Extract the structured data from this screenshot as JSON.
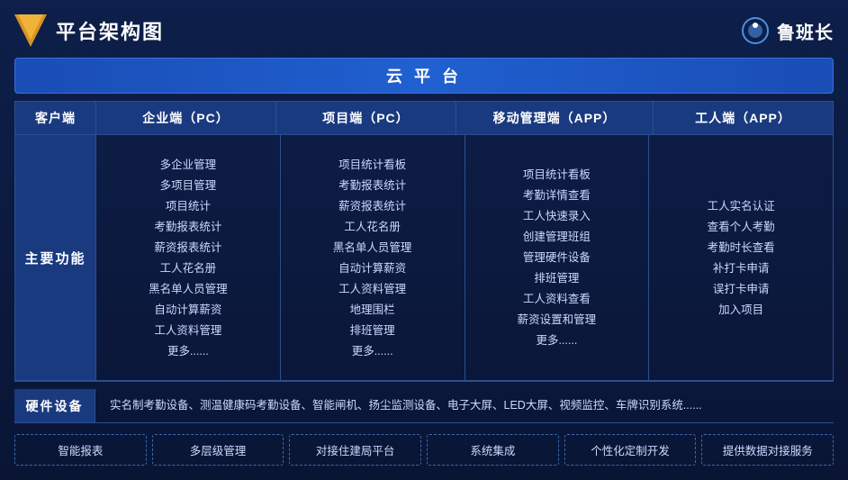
{
  "header": {
    "title": "平台架构图",
    "brand_name": "鲁班长"
  },
  "cloud_platform": {
    "label": "云 平 台"
  },
  "columns": [
    {
      "id": "client",
      "label": "客户端"
    },
    {
      "id": "enterprise",
      "label": "企业端（PC）"
    },
    {
      "id": "project",
      "label": "项目端（PC）"
    },
    {
      "id": "mobile",
      "label": "移动管理端（APP）"
    },
    {
      "id": "worker",
      "label": "工人端（APP）"
    }
  ],
  "main_functions": {
    "label": "主要功能",
    "enterprise_items": [
      "多企业管理",
      "多项目管理",
      "项目统计",
      "考勤报表统计",
      "薪资报表统计",
      "工人花名册",
      "黑名单人员管理",
      "自动计算薪资",
      "工人资料管理",
      "更多......"
    ],
    "project_items": [
      "项目统计看板",
      "考勤报表统计",
      "薪资报表统计",
      "工人花名册",
      "黑名单人员管理",
      "自动计算薪资",
      "工人资料管理",
      "地理围栏",
      "排班管理",
      "更多......"
    ],
    "mobile_items": [
      "项目统计看板",
      "考勤详情查看",
      "工人快速录入",
      "创建管理班组",
      "管理硬件设备",
      "排班管理",
      "工人资料查看",
      "薪资设置和管理",
      "更多......"
    ],
    "worker_items": [
      "工人实名认证",
      "查看个人考勤",
      "考勤时长查看",
      "补打卡申请",
      "误打卡申请",
      "加入项目"
    ]
  },
  "hardware": {
    "label": "硬件设备",
    "content": "实名制考勤设备、测温健康码考勤设备、智能闸机、扬尘监测设备、电子大屏、LED大屏、视频监控、车牌识别系统......"
  },
  "tags": [
    "智能报表",
    "多层级管理",
    "对接住建局平台",
    "系统集成",
    "个性化定制开发",
    "提供数据对接服务"
  ]
}
